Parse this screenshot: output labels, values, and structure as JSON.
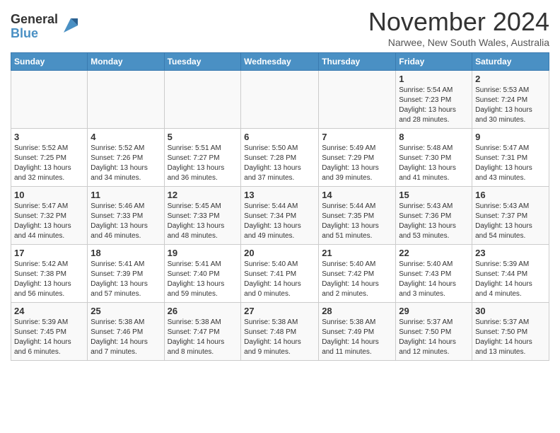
{
  "header": {
    "logo_general": "General",
    "logo_blue": "Blue",
    "month_title": "November 2024",
    "location": "Narwee, New South Wales, Australia"
  },
  "weekdays": [
    "Sunday",
    "Monday",
    "Tuesday",
    "Wednesday",
    "Thursday",
    "Friday",
    "Saturday"
  ],
  "weeks": [
    [
      {
        "day": "",
        "info": ""
      },
      {
        "day": "",
        "info": ""
      },
      {
        "day": "",
        "info": ""
      },
      {
        "day": "",
        "info": ""
      },
      {
        "day": "",
        "info": ""
      },
      {
        "day": "1",
        "info": "Sunrise: 5:54 AM\nSunset: 7:23 PM\nDaylight: 13 hours\nand 28 minutes."
      },
      {
        "day": "2",
        "info": "Sunrise: 5:53 AM\nSunset: 7:24 PM\nDaylight: 13 hours\nand 30 minutes."
      }
    ],
    [
      {
        "day": "3",
        "info": "Sunrise: 5:52 AM\nSunset: 7:25 PM\nDaylight: 13 hours\nand 32 minutes."
      },
      {
        "day": "4",
        "info": "Sunrise: 5:52 AM\nSunset: 7:26 PM\nDaylight: 13 hours\nand 34 minutes."
      },
      {
        "day": "5",
        "info": "Sunrise: 5:51 AM\nSunset: 7:27 PM\nDaylight: 13 hours\nand 36 minutes."
      },
      {
        "day": "6",
        "info": "Sunrise: 5:50 AM\nSunset: 7:28 PM\nDaylight: 13 hours\nand 37 minutes."
      },
      {
        "day": "7",
        "info": "Sunrise: 5:49 AM\nSunset: 7:29 PM\nDaylight: 13 hours\nand 39 minutes."
      },
      {
        "day": "8",
        "info": "Sunrise: 5:48 AM\nSunset: 7:30 PM\nDaylight: 13 hours\nand 41 minutes."
      },
      {
        "day": "9",
        "info": "Sunrise: 5:47 AM\nSunset: 7:31 PM\nDaylight: 13 hours\nand 43 minutes."
      }
    ],
    [
      {
        "day": "10",
        "info": "Sunrise: 5:47 AM\nSunset: 7:32 PM\nDaylight: 13 hours\nand 44 minutes."
      },
      {
        "day": "11",
        "info": "Sunrise: 5:46 AM\nSunset: 7:33 PM\nDaylight: 13 hours\nand 46 minutes."
      },
      {
        "day": "12",
        "info": "Sunrise: 5:45 AM\nSunset: 7:33 PM\nDaylight: 13 hours\nand 48 minutes."
      },
      {
        "day": "13",
        "info": "Sunrise: 5:44 AM\nSunset: 7:34 PM\nDaylight: 13 hours\nand 49 minutes."
      },
      {
        "day": "14",
        "info": "Sunrise: 5:44 AM\nSunset: 7:35 PM\nDaylight: 13 hours\nand 51 minutes."
      },
      {
        "day": "15",
        "info": "Sunrise: 5:43 AM\nSunset: 7:36 PM\nDaylight: 13 hours\nand 53 minutes."
      },
      {
        "day": "16",
        "info": "Sunrise: 5:43 AM\nSunset: 7:37 PM\nDaylight: 13 hours\nand 54 minutes."
      }
    ],
    [
      {
        "day": "17",
        "info": "Sunrise: 5:42 AM\nSunset: 7:38 PM\nDaylight: 13 hours\nand 56 minutes."
      },
      {
        "day": "18",
        "info": "Sunrise: 5:41 AM\nSunset: 7:39 PM\nDaylight: 13 hours\nand 57 minutes."
      },
      {
        "day": "19",
        "info": "Sunrise: 5:41 AM\nSunset: 7:40 PM\nDaylight: 13 hours\nand 59 minutes."
      },
      {
        "day": "20",
        "info": "Sunrise: 5:40 AM\nSunset: 7:41 PM\nDaylight: 14 hours\nand 0 minutes."
      },
      {
        "day": "21",
        "info": "Sunrise: 5:40 AM\nSunset: 7:42 PM\nDaylight: 14 hours\nand 2 minutes."
      },
      {
        "day": "22",
        "info": "Sunrise: 5:40 AM\nSunset: 7:43 PM\nDaylight: 14 hours\nand 3 minutes."
      },
      {
        "day": "23",
        "info": "Sunrise: 5:39 AM\nSunset: 7:44 PM\nDaylight: 14 hours\nand 4 minutes."
      }
    ],
    [
      {
        "day": "24",
        "info": "Sunrise: 5:39 AM\nSunset: 7:45 PM\nDaylight: 14 hours\nand 6 minutes."
      },
      {
        "day": "25",
        "info": "Sunrise: 5:38 AM\nSunset: 7:46 PM\nDaylight: 14 hours\nand 7 minutes."
      },
      {
        "day": "26",
        "info": "Sunrise: 5:38 AM\nSunset: 7:47 PM\nDaylight: 14 hours\nand 8 minutes."
      },
      {
        "day": "27",
        "info": "Sunrise: 5:38 AM\nSunset: 7:48 PM\nDaylight: 14 hours\nand 9 minutes."
      },
      {
        "day": "28",
        "info": "Sunrise: 5:38 AM\nSunset: 7:49 PM\nDaylight: 14 hours\nand 11 minutes."
      },
      {
        "day": "29",
        "info": "Sunrise: 5:37 AM\nSunset: 7:50 PM\nDaylight: 14 hours\nand 12 minutes."
      },
      {
        "day": "30",
        "info": "Sunrise: 5:37 AM\nSunset: 7:50 PM\nDaylight: 14 hours\nand 13 minutes."
      }
    ]
  ]
}
